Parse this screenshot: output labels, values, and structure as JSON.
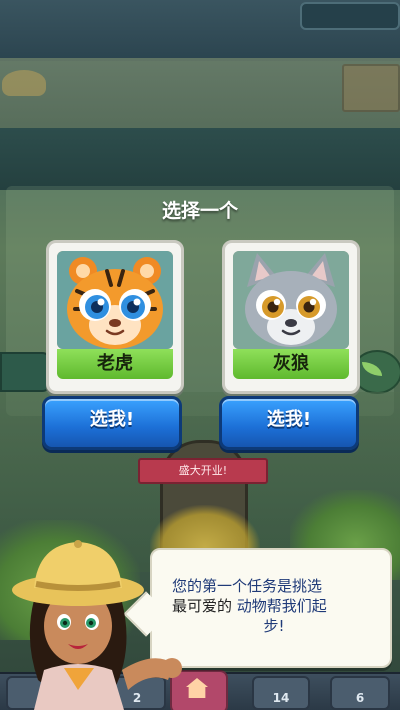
{
  "screen": {
    "title": "选择一个"
  },
  "choices": [
    {
      "animal": "老虎",
      "pick_label": "选我!",
      "portrait_icon": "tiger-face-icon",
      "portrait_bg": "#d8b36a"
    },
    {
      "animal": "灰狼",
      "pick_label": "选我!",
      "portrait_icon": "wolf-face-icon",
      "portrait_bg": "#9aa48c"
    }
  ],
  "shop": {
    "banner": "盛大开业!"
  },
  "dialog": {
    "line1": "您的第一个任务是挑选",
    "line2_dark": "最可爱的",
    "line2_blue": "动物帮我们起",
    "line3": "步!"
  },
  "bottom_nav": {
    "slot_left_count": "2",
    "slot_mid_count": "14",
    "slot_right_count": "6",
    "home_icon": "home-icon",
    "menu_icon": "menu-icon"
  },
  "colors": {
    "pick_button": "#1c6fd6",
    "label_green": "#5fb92e",
    "dialog_text": "#1f3a78",
    "shop_banner": "#b83a4e"
  }
}
